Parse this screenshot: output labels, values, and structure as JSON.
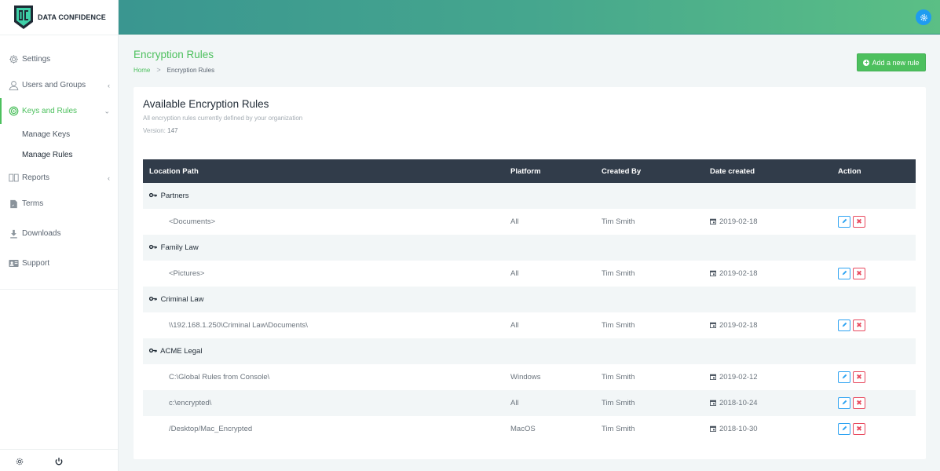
{
  "brand": {
    "name": "DATA CONFIDENCE"
  },
  "sidebar": {
    "items": [
      {
        "label": "Settings",
        "icon": "gear-icon",
        "chevron": ""
      },
      {
        "label": "Users and Groups",
        "icon": "user-icon",
        "chevron": "‹"
      },
      {
        "label": "Keys and Rules",
        "icon": "target-icon",
        "chevron": "⌄",
        "active": true
      },
      {
        "label": "Reports",
        "icon": "book-icon",
        "chevron": "‹"
      },
      {
        "label": "Terms",
        "icon": "document-icon",
        "chevron": ""
      },
      {
        "label": "Downloads",
        "icon": "download-icon",
        "chevron": ""
      },
      {
        "label": "Support",
        "icon": "id-card-icon",
        "chevron": ""
      }
    ],
    "subitems": [
      {
        "label": "Manage Keys"
      },
      {
        "label": "Manage Rules",
        "current": true
      }
    ]
  },
  "page": {
    "title": "Encryption Rules",
    "breadcrumb": {
      "home": "Home",
      "separator": ">",
      "current": "Encryption Rules"
    },
    "add_button": "Add a new rule"
  },
  "card": {
    "title": "Available Encryption Rules",
    "subtitle": "All encryption rules currently defined by your organization",
    "version_label": "Version:",
    "version_value": "147"
  },
  "table": {
    "headers": [
      "Location Path",
      "Platform",
      "Created By",
      "Date created",
      "Action"
    ],
    "groups": [
      {
        "name": "Partners",
        "rules": [
          {
            "path": "<Documents>",
            "platform": "All",
            "created_by": "Tim Smith",
            "date": "2019-02-18"
          }
        ]
      },
      {
        "name": "Family Law",
        "rules": [
          {
            "path": "<Pictures>",
            "platform": "All",
            "created_by": "Tim Smith",
            "date": "2019-02-18"
          }
        ]
      },
      {
        "name": "Criminal Law",
        "rules": [
          {
            "path": "\\\\192.168.1.250\\Criminal Law\\Documents\\",
            "platform": "All",
            "created_by": "Tim Smith",
            "date": "2019-02-18"
          }
        ]
      },
      {
        "name": "ACME Legal",
        "rules": [
          {
            "path": "C:\\Global Rules from Console\\",
            "platform": "Windows",
            "created_by": "Tim Smith",
            "date": "2019-02-12"
          },
          {
            "path": "c:\\encrypted\\",
            "platform": "All",
            "created_by": "Tim Smith",
            "date": "2018-10-24"
          },
          {
            "path": "/Desktop/Mac_Encrypted",
            "platform": "MacOS",
            "created_by": "Tim Smith",
            "date": "2018-10-30"
          }
        ]
      }
    ],
    "actions": {
      "edit_icon": "pencil-icon",
      "delete_icon": "close-icon",
      "delete_glyph": "✖"
    }
  },
  "colors": {
    "accent": "#4dc05e",
    "header_dark": "#313c4a",
    "edit": "#2ea3f2",
    "delete": "#e84a5f",
    "gear_button": "#1f9cf0"
  }
}
